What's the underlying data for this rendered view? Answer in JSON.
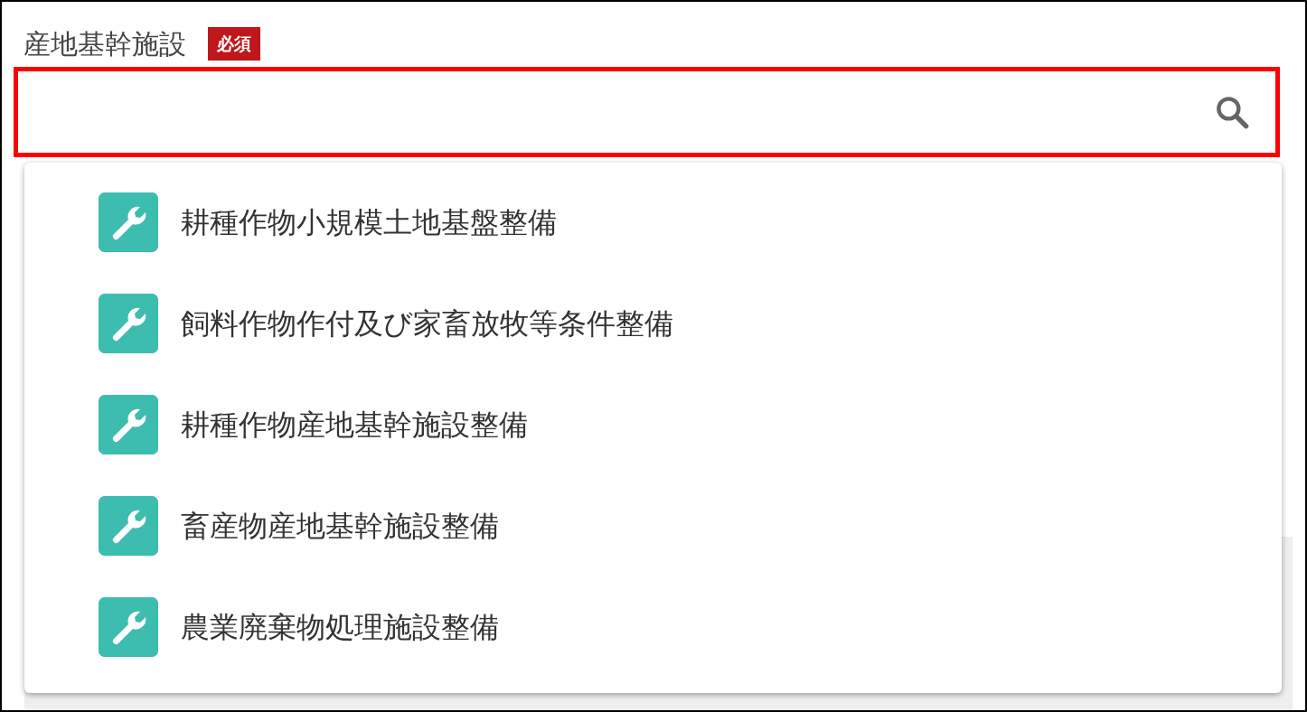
{
  "field": {
    "label": "産地基幹施設",
    "required_badge": "必須"
  },
  "suggestions": [
    {
      "label": "耕種作物小規模土地基盤整備"
    },
    {
      "label": "飼料作物作付及び家畜放牧等条件整備"
    },
    {
      "label": "耕種作物産地基幹施設整備"
    },
    {
      "label": "畜産物産地基幹施設整備"
    },
    {
      "label": "農業廃棄物処理施設整備"
    }
  ]
}
